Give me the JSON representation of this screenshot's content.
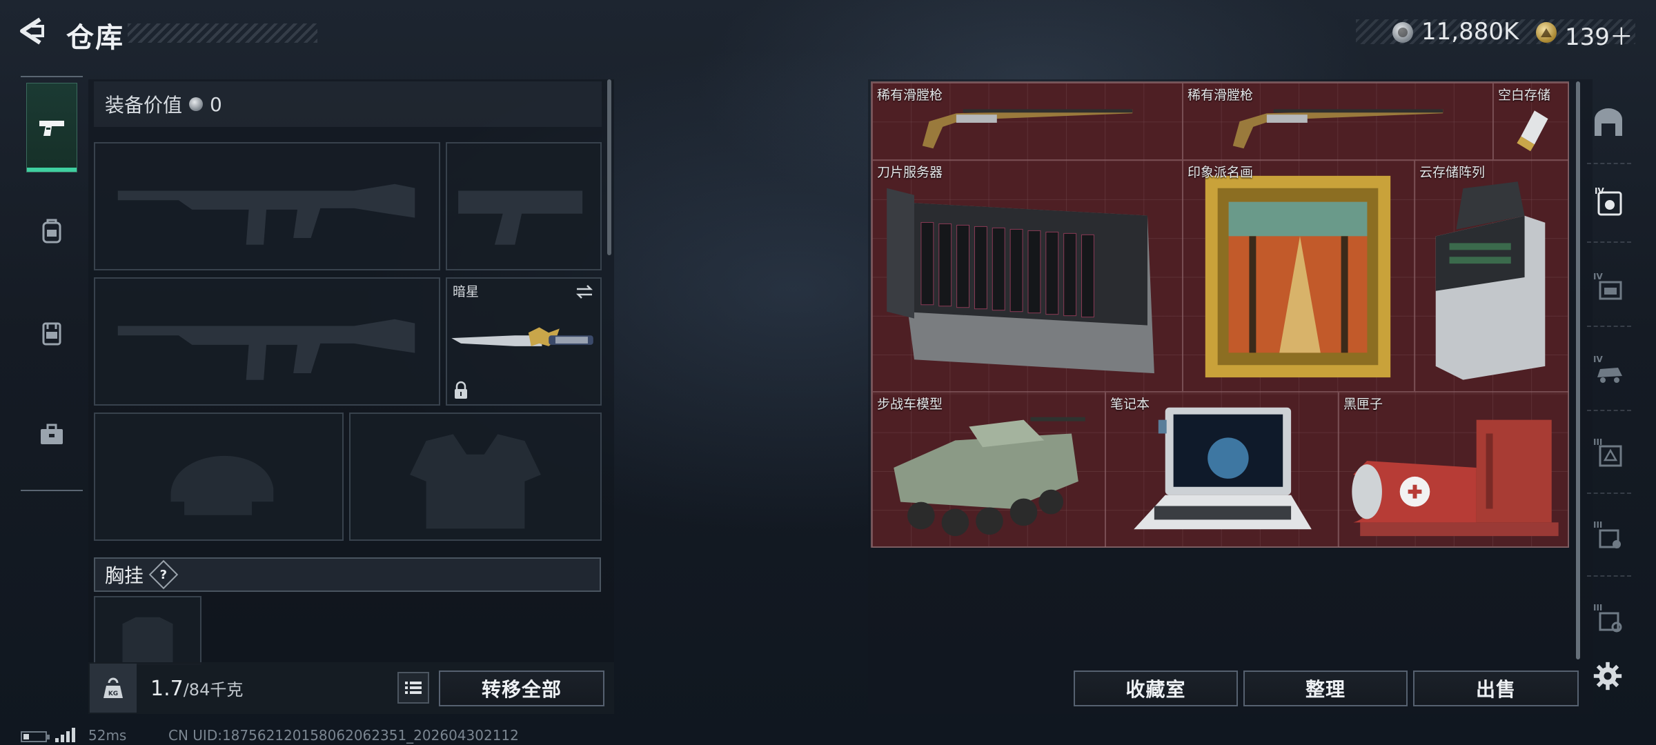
{
  "header": {
    "title": "仓库",
    "money": "11,880K",
    "tickets": "139＋"
  },
  "left_rail": {
    "tabs": [
      {
        "name": "weapons",
        "icon": "pistol-icon",
        "active": true
      },
      {
        "name": "backpack",
        "icon": "backpack-icon"
      },
      {
        "name": "vest",
        "icon": "vest-icon"
      },
      {
        "name": "case",
        "icon": "briefcase-icon"
      }
    ]
  },
  "loadout": {
    "value_label": "装备价值",
    "value": "0",
    "melee_slot_name": "暗星",
    "chest_rig_label": "胸挂",
    "help_glyph": "?",
    "weight_current": "1.7",
    "weight_max": "/84千克",
    "kg_label": "KG",
    "transfer_all": "转移全部"
  },
  "stash": {
    "items": [
      {
        "name": "稀有滑膛枪",
        "icon": "musket-icon"
      },
      {
        "name": "稀有滑膛枪",
        "icon": "musket-icon"
      },
      {
        "name": "空白存储",
        "icon": "usb-drive-icon"
      },
      {
        "name": "刀片服务器",
        "icon": "blade-server-icon"
      },
      {
        "name": "印象派名画",
        "icon": "painting-icon"
      },
      {
        "name": "云存储阵列",
        "icon": "storage-array-icon"
      },
      {
        "name": "步战车模型",
        "icon": "ifv-model-icon"
      },
      {
        "name": "笔记本",
        "icon": "laptop-icon"
      },
      {
        "name": "黑匣子",
        "icon": "black-box-icon"
      }
    ],
    "buttons": {
      "collection": "收藏室",
      "tidy": "整理",
      "sell": "出售"
    }
  },
  "right_rail": {
    "tiers": [
      "IV",
      "IV",
      "IV",
      "III",
      "III",
      "III"
    ]
  },
  "status": {
    "ping": "52ms",
    "uid": "CN UID:18756212015806206235­1_202604302112"
  },
  "colors": {
    "stash_bg": "#4e1f24",
    "active_tab": "#3fd0a0",
    "text": "#d8dde2"
  }
}
